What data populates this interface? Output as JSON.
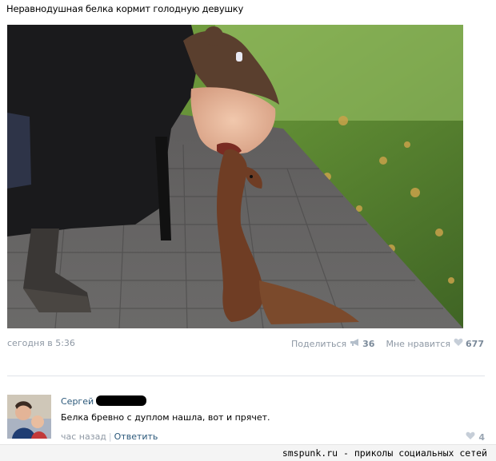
{
  "post": {
    "text": "Неравнодушная белка кормит голодную девушку",
    "time": "сегодня в 5:36",
    "share_label": "Поделиться",
    "share_count": "36",
    "like_label": "Мне нравится",
    "like_count": "677"
  },
  "comment": {
    "author": "Сергей",
    "text": "Белка бревно с дуплом нашла, вот и прячет.",
    "time": "час назад",
    "reply_label": "Ответить",
    "like_count": "4"
  },
  "footer": {
    "watermark": "smspunk.ru - приколы социальных сетей"
  }
}
